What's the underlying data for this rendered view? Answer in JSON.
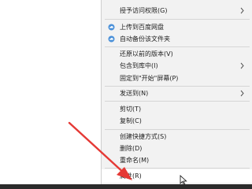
{
  "menu": {
    "items": [
      {
        "label": "授予访问权限(G)",
        "submenu": true,
        "icon": null
      },
      {
        "label": "上传到百度网盘",
        "submenu": false,
        "icon": "baidu-cloud-icon"
      },
      {
        "label": "自动备份该文件夹",
        "submenu": false,
        "icon": "baidu-cloud-icon"
      },
      {
        "label": "还原以前的版本(V)",
        "submenu": false,
        "icon": null
      },
      {
        "label": "包含到库中(I)",
        "submenu": true,
        "icon": null
      },
      {
        "label": "固定到\"开始\"屏幕(P)",
        "submenu": false,
        "icon": null
      },
      {
        "label": "发送到(N)",
        "submenu": true,
        "icon": null
      },
      {
        "label": "剪切(T)",
        "submenu": false,
        "icon": null
      },
      {
        "label": "复制(C)",
        "submenu": false,
        "icon": null
      },
      {
        "label": "创建快捷方式(S)",
        "submenu": false,
        "icon": null
      },
      {
        "label": "删除(D)",
        "submenu": false,
        "icon": null
      },
      {
        "label": "重命名(M)",
        "submenu": false,
        "icon": null
      },
      {
        "label": "属性(R)",
        "submenu": false,
        "icon": null,
        "highlighted": true
      }
    ]
  },
  "colors": {
    "menu_background": "#f2f2f2",
    "highlight": "#ffffff",
    "annotation_arrow": "#e53935",
    "cloud_icon": "#4a90d9"
  }
}
